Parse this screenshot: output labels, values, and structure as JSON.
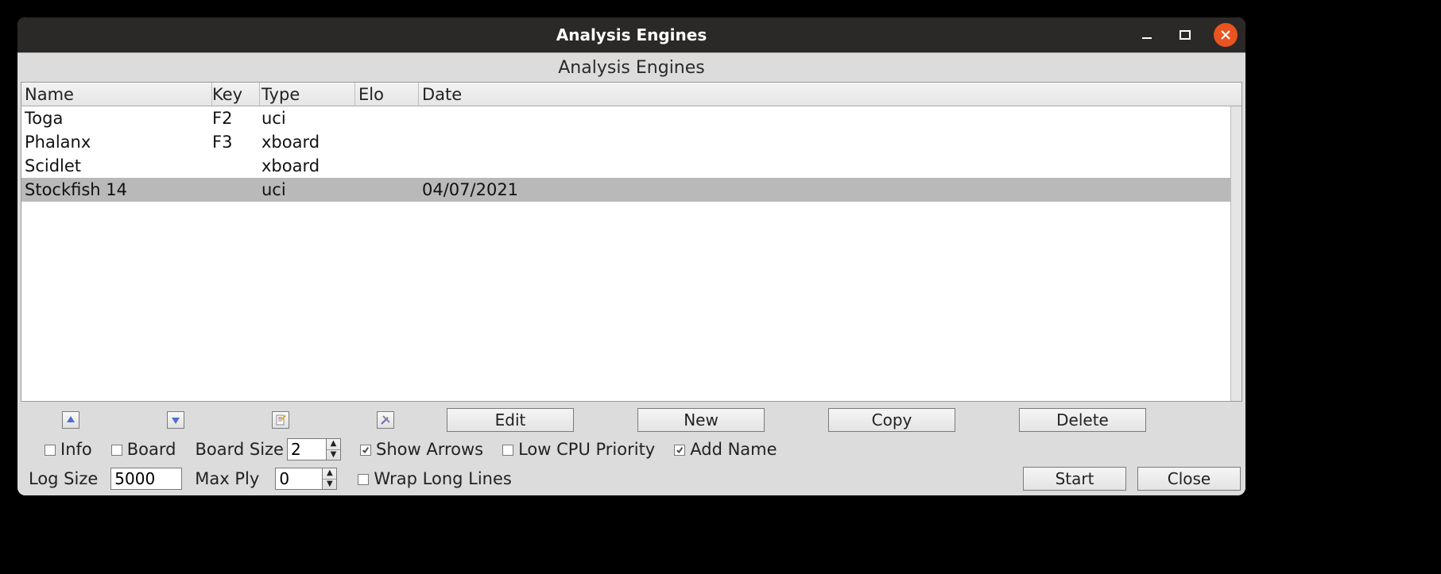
{
  "window": {
    "title": "Analysis Engines"
  },
  "dialog": {
    "title": "Analysis Engines"
  },
  "table": {
    "headers": {
      "name": "Name",
      "key": "Key",
      "type": "Type",
      "elo": "Elo",
      "date": "Date"
    },
    "rows": [
      {
        "name": "Toga",
        "key": "F2",
        "type": "uci",
        "elo": "",
        "date": "",
        "selected": false
      },
      {
        "name": "Phalanx",
        "key": "F3",
        "type": "xboard",
        "elo": "",
        "date": "",
        "selected": false
      },
      {
        "name": "Scidlet",
        "key": "",
        "type": "xboard",
        "elo": "",
        "date": "",
        "selected": false
      },
      {
        "name": "Stockfish 14",
        "key": "",
        "type": "uci",
        "elo": "",
        "date": "04/07/2021",
        "selected": true
      }
    ]
  },
  "toolbar": {
    "edit": "Edit",
    "new": "New",
    "copy": "Copy",
    "delete": "Delete"
  },
  "options": {
    "info_label": "Info",
    "info_checked": false,
    "board_label": "Board",
    "board_checked": false,
    "board_size_label": "Board Size",
    "board_size_value": "2",
    "show_arrows_label": "Show Arrows",
    "show_arrows_checked": true,
    "low_cpu_label": "Low CPU Priority",
    "low_cpu_checked": false,
    "add_name_label": "Add Name",
    "add_name_checked": true
  },
  "bottom": {
    "log_size_label": "Log Size",
    "log_size_value": "5000",
    "max_ply_label": "Max Ply",
    "max_ply_value": "0",
    "wrap_label": "Wrap Long Lines",
    "wrap_checked": false,
    "start": "Start",
    "close": "Close"
  }
}
